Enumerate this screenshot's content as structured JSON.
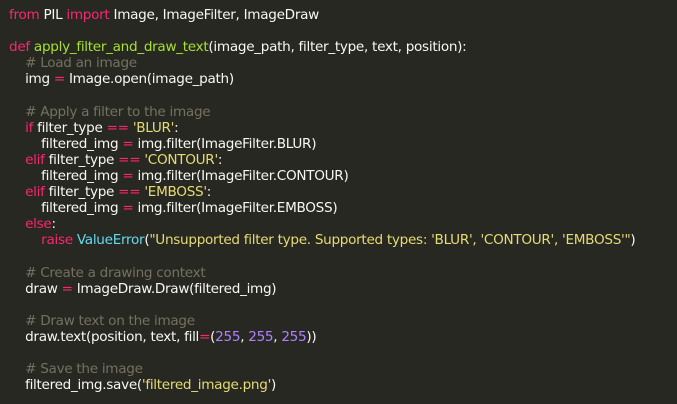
{
  "colors": {
    "background": "#272822",
    "plain": "#f8f8f2",
    "keyword": "#f92672",
    "function": "#a6e22e",
    "string": "#e6db74",
    "number": "#ae81ff",
    "comment": "#75715e",
    "builtin": "#66d9ef"
  },
  "code": {
    "lines": [
      [
        [
          "kw",
          "from"
        ],
        [
          "plain",
          " PIL "
        ],
        [
          "kw",
          "import"
        ],
        [
          "plain",
          " Image, ImageFilter, ImageDraw"
        ]
      ],
      [],
      [
        [
          "kw",
          "def"
        ],
        [
          "plain",
          " "
        ],
        [
          "fn",
          "apply_filter_and_draw_text"
        ],
        [
          "plain",
          "(image_path, filter_type, text, position):"
        ]
      ],
      [
        [
          "plain",
          "    "
        ],
        [
          "cm",
          "# Load an image"
        ]
      ],
      [
        [
          "plain",
          "    img "
        ],
        [
          "op",
          "="
        ],
        [
          "plain",
          " Image.open(image_path)"
        ]
      ],
      [],
      [
        [
          "plain",
          "    "
        ],
        [
          "cm",
          "# Apply a filter to the image"
        ]
      ],
      [
        [
          "plain",
          "    "
        ],
        [
          "kw",
          "if"
        ],
        [
          "plain",
          " filter_type "
        ],
        [
          "op",
          "=="
        ],
        [
          "plain",
          " "
        ],
        [
          "str",
          "'BLUR'"
        ],
        [
          "plain",
          ":"
        ]
      ],
      [
        [
          "plain",
          "        filtered_img "
        ],
        [
          "op",
          "="
        ],
        [
          "plain",
          " img.filter(ImageFilter.BLUR)"
        ]
      ],
      [
        [
          "plain",
          "    "
        ],
        [
          "kw",
          "elif"
        ],
        [
          "plain",
          " filter_type "
        ],
        [
          "op",
          "=="
        ],
        [
          "plain",
          " "
        ],
        [
          "str",
          "'CONTOUR'"
        ],
        [
          "plain",
          ":"
        ]
      ],
      [
        [
          "plain",
          "        filtered_img "
        ],
        [
          "op",
          "="
        ],
        [
          "plain",
          " img.filter(ImageFilter.CONTOUR)"
        ]
      ],
      [
        [
          "plain",
          "    "
        ],
        [
          "kw",
          "elif"
        ],
        [
          "plain",
          " filter_type "
        ],
        [
          "op",
          "=="
        ],
        [
          "plain",
          " "
        ],
        [
          "str",
          "'EMBOSS'"
        ],
        [
          "plain",
          ":"
        ]
      ],
      [
        [
          "plain",
          "        filtered_img "
        ],
        [
          "op",
          "="
        ],
        [
          "plain",
          " img.filter(ImageFilter.EMBOSS)"
        ]
      ],
      [
        [
          "plain",
          "    "
        ],
        [
          "kw",
          "else"
        ],
        [
          "plain",
          ":"
        ]
      ],
      [
        [
          "plain",
          "        "
        ],
        [
          "kw",
          "raise"
        ],
        [
          "plain",
          " "
        ],
        [
          "builtin",
          "ValueError"
        ],
        [
          "plain",
          "("
        ],
        [
          "str",
          "\"Unsupported filter type. Supported types: 'BLUR', 'CONTOUR', 'EMBOSS'\""
        ],
        [
          "plain",
          ")"
        ]
      ],
      [],
      [
        [
          "plain",
          "    "
        ],
        [
          "cm",
          "# Create a drawing context"
        ]
      ],
      [
        [
          "plain",
          "    draw "
        ],
        [
          "op",
          "="
        ],
        [
          "plain",
          " ImageDraw.Draw(filtered_img)"
        ]
      ],
      [],
      [
        [
          "plain",
          "    "
        ],
        [
          "cm",
          "# Draw text on the image"
        ]
      ],
      [
        [
          "plain",
          "    draw.text(position, text, fill"
        ],
        [
          "op",
          "="
        ],
        [
          "plain",
          "("
        ],
        [
          "num",
          "255"
        ],
        [
          "plain",
          ", "
        ],
        [
          "num",
          "255"
        ],
        [
          "plain",
          ", "
        ],
        [
          "num",
          "255"
        ],
        [
          "plain",
          "))"
        ]
      ],
      [],
      [
        [
          "plain",
          "    "
        ],
        [
          "cm",
          "# Save the image"
        ]
      ],
      [
        [
          "plain",
          "    filtered_img.save("
        ],
        [
          "str",
          "'filtered_image.png'"
        ],
        [
          "plain",
          ")"
        ]
      ]
    ]
  }
}
